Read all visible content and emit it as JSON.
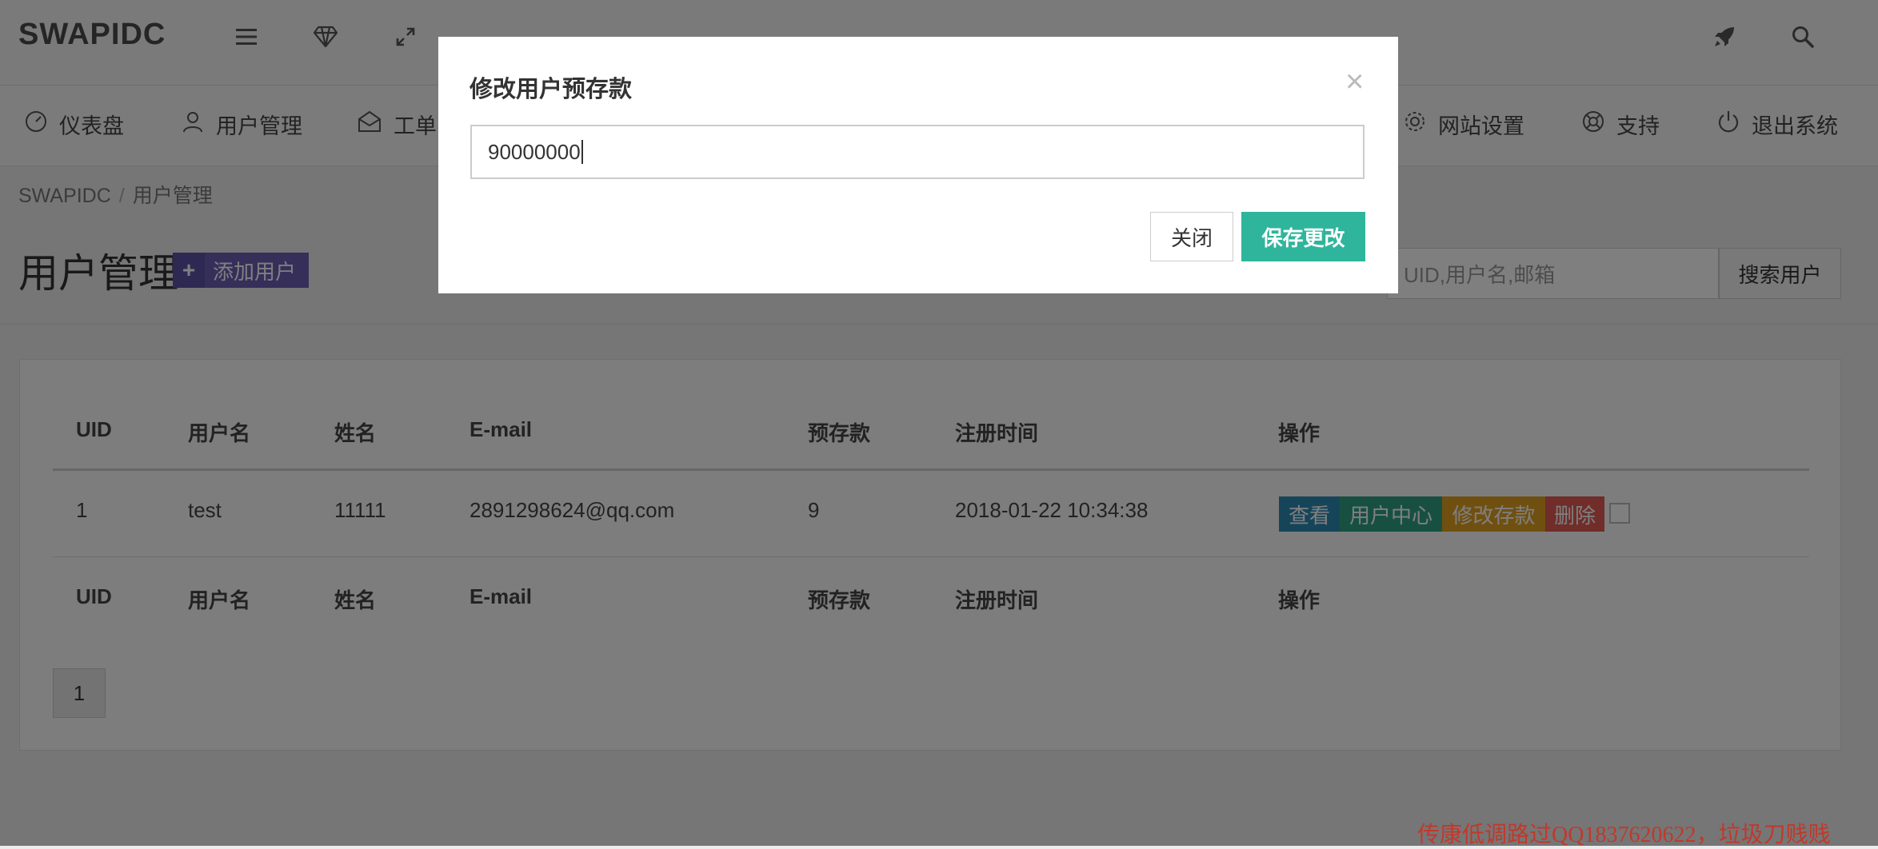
{
  "header": {
    "logo": "SWAPIDC",
    "icons": [
      "menu-icon",
      "diamond-icon",
      "expand-icon",
      "rocket-icon",
      "search-icon"
    ]
  },
  "nav": {
    "items": [
      {
        "label": "仪表盘",
        "icon": "gauge-icon"
      },
      {
        "label": "用户管理",
        "icon": "user-icon"
      },
      {
        "label": "工单",
        "icon": "envelope-icon"
      },
      {
        "label": "网站设置",
        "icon": "gear-icon"
      },
      {
        "label": "支持",
        "icon": "lifebuoy-icon"
      },
      {
        "label": "退出系统",
        "icon": "power-icon"
      }
    ]
  },
  "breadcrumb": {
    "root": "SWAPIDC",
    "separator": "/",
    "current": "用户管理"
  },
  "page": {
    "title": "用户管理",
    "add_button_icon": "+",
    "add_button_label": "添加用户",
    "search_placeholder": "UID,用户名,邮箱",
    "search_button": "搜索用户"
  },
  "table": {
    "columns": [
      "UID",
      "用户名",
      "姓名",
      "E-mail",
      "预存款",
      "注册时间",
      "操作"
    ],
    "rows": [
      {
        "uid": "1",
        "username": "test",
        "name": "11111",
        "email": "2891298624@qq.com",
        "balance": "9",
        "registered": "2018-01-22 10:34:38"
      }
    ],
    "actions": [
      {
        "label": "查看",
        "color": "#2d8bb5"
      },
      {
        "label": "用户中心",
        "color": "#2fa083"
      },
      {
        "label": "修改存款",
        "color": "#e0a020"
      },
      {
        "label": "删除",
        "color": "#e05a52"
      }
    ],
    "footer_columns": [
      "UID",
      "用户名",
      "姓名",
      "E-mail",
      "预存款",
      "注册时间",
      "操作"
    ]
  },
  "pagination": {
    "current": "1"
  },
  "modal": {
    "title": "修改用户预存款",
    "close_symbol": "×",
    "input_value": "90000000",
    "close_button": "关闭",
    "save_button": "保存更改"
  },
  "watermark": "传康低调路过QQ1837620622，垃圾刀贱贱",
  "colors": {
    "accent": "#2fb59c",
    "add_button": "#6a5fb5",
    "overlay": "rgba(0,0,0,0.5)"
  }
}
